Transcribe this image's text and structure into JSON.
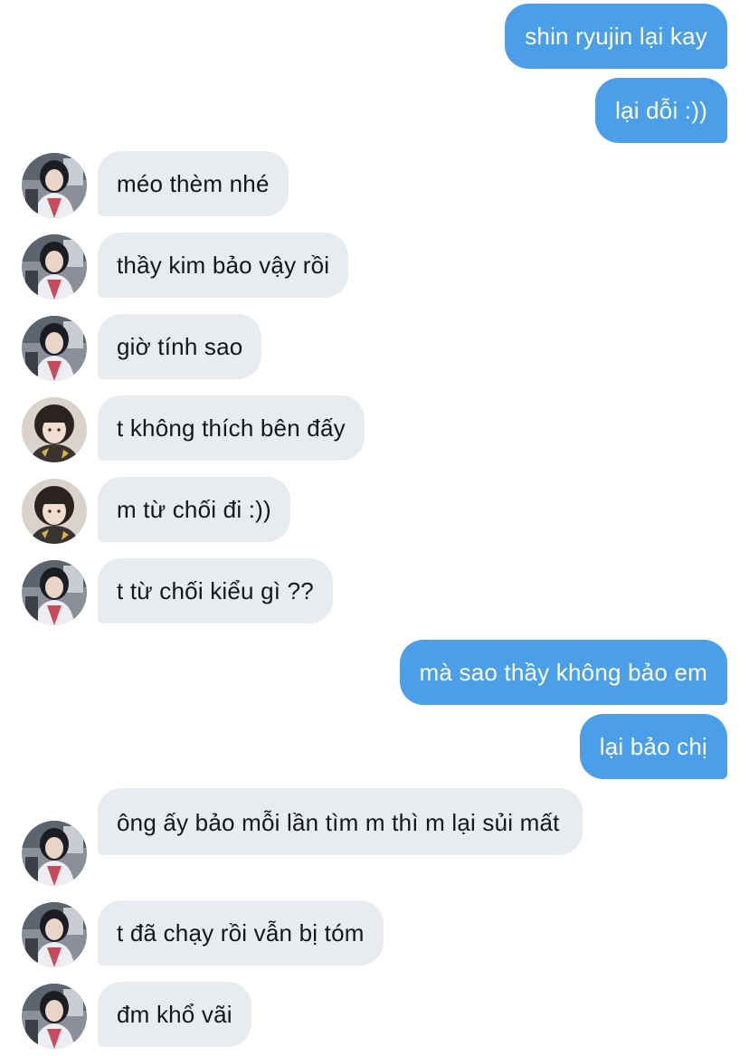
{
  "conversation": {
    "messages": [
      {
        "direction": "out",
        "text": "shin ryujin lại kay"
      },
      {
        "direction": "out",
        "text": "lại dỗi :))"
      },
      {
        "direction": "in",
        "sender_avatar": "avatar-a",
        "text": "méo thèm nhé"
      },
      {
        "direction": "in",
        "sender_avatar": "avatar-a",
        "text": "thầy kim bảo vậy rồi"
      },
      {
        "direction": "in",
        "sender_avatar": "avatar-a",
        "text": "giờ tính sao"
      },
      {
        "direction": "in",
        "sender_avatar": "avatar-b",
        "text": "t không thích bên đấy"
      },
      {
        "direction": "in",
        "sender_avatar": "avatar-b",
        "text": "m từ chối đi :))"
      },
      {
        "direction": "in",
        "sender_avatar": "avatar-a",
        "text": "t từ chối kiểu gì ??"
      },
      {
        "direction": "out",
        "text": "mà sao thầy không bảo em"
      },
      {
        "direction": "out",
        "text": "lại bảo chị"
      },
      {
        "direction": "in",
        "sender_avatar": "avatar-a",
        "text": "ông ấy bảo mỗi lần tìm m thì m lại sủi mất"
      },
      {
        "direction": "in",
        "sender_avatar": "avatar-a",
        "text": "t đã chạy rồi vẫn bị tóm"
      },
      {
        "direction": "in",
        "sender_avatar": "avatar-a",
        "text": "đm khổ vãi"
      }
    ]
  },
  "colors": {
    "outgoing_bubble": "#4a9fe8",
    "incoming_bubble": "#e8ebef",
    "incoming_text": "#14171a",
    "outgoing_text": "#ffffff"
  }
}
